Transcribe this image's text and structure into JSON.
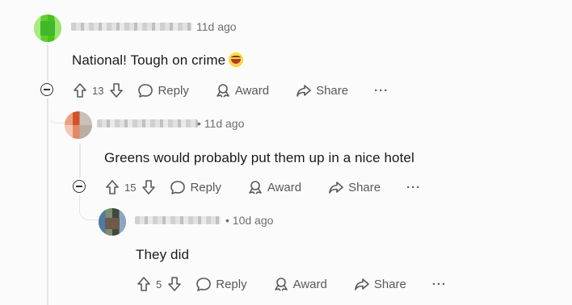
{
  "comments": [
    {
      "time": "11d ago",
      "text": "National! Tough on crime",
      "score": "13",
      "reply_label": "Reply",
      "award_label": "Award",
      "share_label": "Share",
      "more_label": "···"
    },
    {
      "time": "• 11d ago",
      "text": "Greens would probably put them up in a nice hotel",
      "score": "15",
      "reply_label": "Reply",
      "award_label": "Award",
      "share_label": "Share",
      "more_label": "···"
    },
    {
      "time": "• 10d ago",
      "text": "They did",
      "score": "5",
      "reply_label": "Reply",
      "award_label": "Award",
      "share_label": "Share",
      "more_label": "···"
    }
  ],
  "icons": {
    "upvote": "upvote-icon",
    "downvote": "downvote-icon",
    "reply": "reply-icon",
    "award": "award-icon",
    "share": "share-icon",
    "collapse": "collapse-icon",
    "emoji": "laughing-emoji"
  },
  "colors": {
    "meta": "#6b6e71",
    "thread_line": "#e3e5e8"
  }
}
